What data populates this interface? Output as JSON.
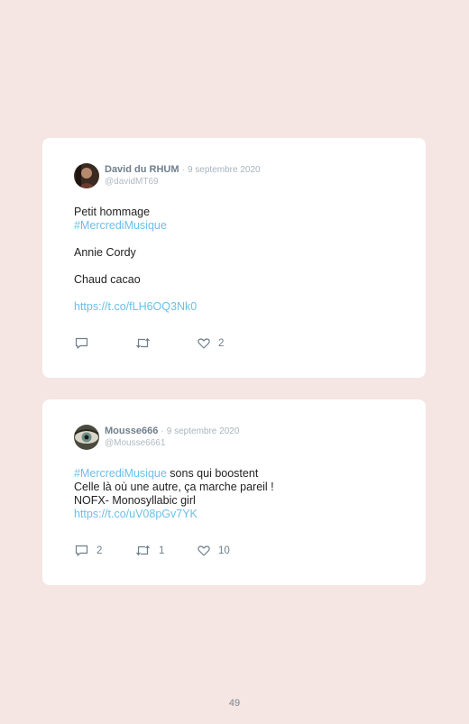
{
  "tweets": [
    {
      "display_name": "David du RHUM",
      "separator": "·",
      "date": "9 septembre 2020",
      "handle": "@davidMT69",
      "lines": [
        {
          "text": "Petit hommage",
          "link": false
        },
        {
          "text": "#MercrediMusique",
          "link": true
        },
        {
          "text": "",
          "link": false
        },
        {
          "text": "Annie Cordy",
          "link": false
        },
        {
          "text": "",
          "link": false
        },
        {
          "text": "Chaud cacao",
          "link": false
        },
        {
          "text": "",
          "link": false
        },
        {
          "text": "https://t.co/fLH6OQ3Nk0",
          "link": true
        }
      ],
      "replies": "",
      "retweets": "",
      "likes": "2"
    },
    {
      "display_name": "Mousse666",
      "separator": "·",
      "date": "9 septembre 2020",
      "handle": "@Mousse6661",
      "line1_hashtag": "#MercrediMusique",
      "line1_rest": " sons qui boostent",
      "line2": "Celle là où une autre, ça marche pareil !",
      "line3": "NOFX- Monosyllabic girl",
      "line4": "https://t.co/uV08pGv7YK",
      "replies": "2",
      "retweets": "1",
      "likes": "10"
    }
  ],
  "icons": {
    "reply": "reply-icon",
    "retweet": "retweet-icon",
    "like": "heart-icon"
  },
  "colors": {
    "background": "#f5e5e3",
    "card": "#ffffff",
    "link": "#6cc0e8",
    "muted": "#6e7f8c"
  },
  "page_number": "49"
}
